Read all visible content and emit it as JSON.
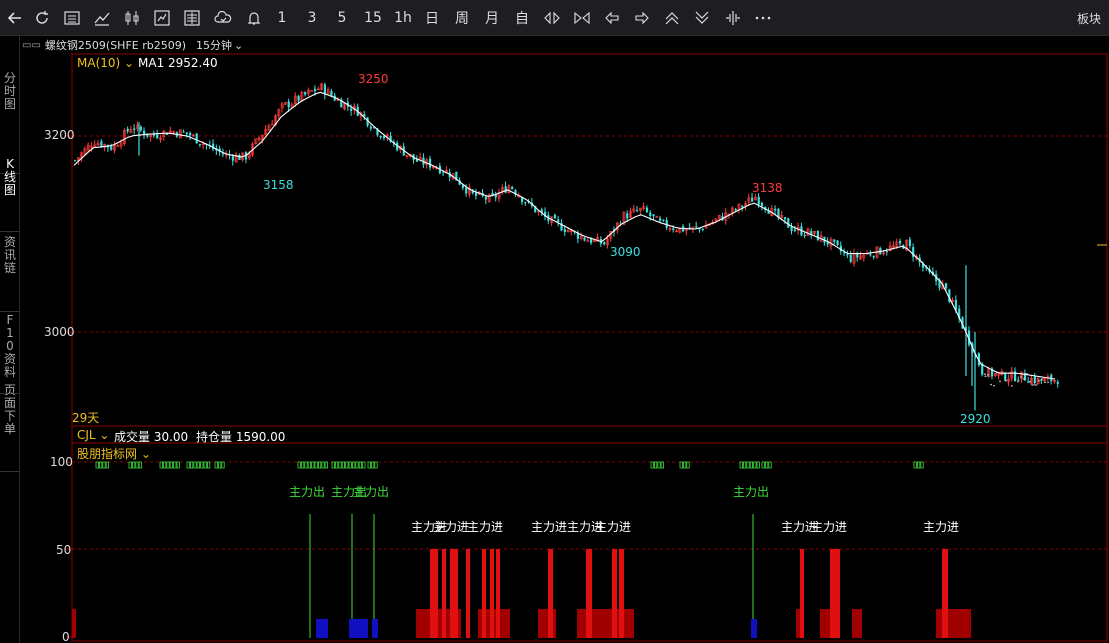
{
  "toolbar": {
    "periods": [
      "1",
      "3",
      "5",
      "15",
      "1h",
      "日",
      "周",
      "月",
      "自"
    ],
    "right_label": "板块"
  },
  "sidetabs": [
    {
      "label": "分时图",
      "chars": [
        "分",
        "时",
        "图"
      ]
    },
    {
      "label": "K线图",
      "chars": [
        "K",
        "线",
        "图"
      ]
    },
    {
      "label": "资讯链",
      "chars": [
        "资",
        "讯",
        "链"
      ]
    },
    {
      "label": "F10资料",
      "chars": [
        "F",
        "1",
        "0",
        "资",
        "料"
      ]
    },
    {
      "label": "页面下单",
      "chars": [
        "页",
        "面",
        "下",
        "单"
      ]
    }
  ],
  "header": {
    "symbol": "螺纹钢2509(SHFE rb2509)",
    "period": "15分钟"
  },
  "main": {
    "ma_label": "MA(10)",
    "ma_value": "MA1 2952.40",
    "days": "29天",
    "yaxis": [
      "3200",
      "3000"
    ],
    "annotations": {
      "high1": "3250",
      "low1": "3158",
      "low2": "3090",
      "high2": "3138",
      "low3": "2920"
    }
  },
  "sub1": {
    "label": "CJL",
    "volume": "成交量 30.00",
    "oi": "持仓量 1590.00"
  },
  "sub2": {
    "label": "股朋指标网",
    "yaxis": [
      "100",
      "50",
      "0"
    ],
    "outflow": "主力出",
    "inflow": "主力进"
  },
  "colors": {
    "up": "#ff3b3b",
    "down": "#3ce0e0",
    "ma": "#ffffff",
    "grid": "#8b0000",
    "flag": "#3ddc3d",
    "inflow": "#e01010",
    "inflow_dark": "#a00000",
    "outflow_bar": "#1010c0"
  },
  "chart_data": {
    "type": "candlestick",
    "ylim": [
      2900,
      3270
    ],
    "yticks": [
      3200,
      3000
    ],
    "close_path": [
      3175,
      3195,
      3188,
      3210,
      3200,
      3205,
      3202,
      3190,
      3180,
      3178,
      3205,
      3230,
      3240,
      3250,
      3235,
      3225,
      3205,
      3190,
      3175,
      3170,
      3160,
      3140,
      3135,
      3150,
      3130,
      3115,
      3105,
      3095,
      3090,
      3118,
      3125,
      3110,
      3105,
      3105,
      3115,
      3125,
      3138,
      3120,
      3105,
      3100,
      3090,
      3075,
      3080,
      3085,
      3090,
      3062,
      3045,
      3005,
      2960,
      2955,
      2955,
      2950,
      2952
    ],
    "ma10_path": [
      3170,
      3188,
      3190,
      3200,
      3202,
      3203,
      3200,
      3192,
      3182,
      3178,
      3195,
      3220,
      3235,
      3245,
      3238,
      3226,
      3208,
      3192,
      3178,
      3170,
      3160,
      3145,
      3138,
      3145,
      3135,
      3118,
      3108,
      3098,
      3092,
      3110,
      3120,
      3112,
      3106,
      3105,
      3112,
      3122,
      3132,
      3122,
      3108,
      3100,
      3092,
      3080,
      3080,
      3083,
      3088,
      3070,
      3050,
      3012,
      2968,
      2958,
      2958,
      2955,
      2952
    ]
  }
}
